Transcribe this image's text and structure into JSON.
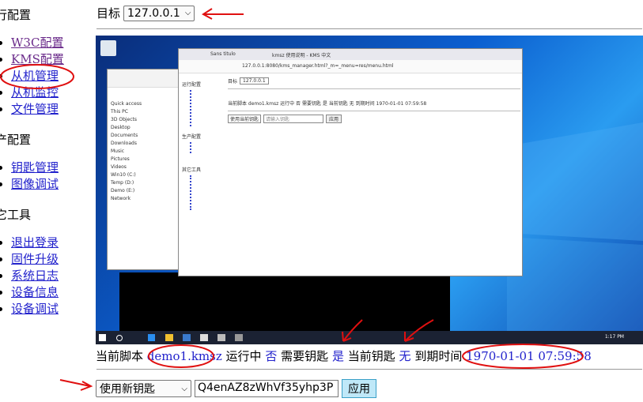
{
  "sidebar": {
    "sections": [
      {
        "title": "行配置",
        "items": [
          "W3C配置",
          "KMS配置",
          "从机管理",
          "从机监控",
          "文件管理"
        ]
      },
      {
        "title": "产配置",
        "items": [
          "钥匙管理",
          "图像调试"
        ]
      },
      {
        "title": "它工具",
        "items": [
          "退出登录",
          "固件升级",
          "系统日志",
          "设备信息",
          "设备调试"
        ]
      }
    ]
  },
  "header": {
    "target_label": "目标",
    "target_value": "127.0.0.1"
  },
  "status": {
    "script_label": "当前脚本",
    "script_value": "demo1.kmsz",
    "running_label": "运行中",
    "running_value": "否",
    "need_key_label": "需要钥匙",
    "need_key_value": "是",
    "current_key_label": "当前钥匙",
    "current_key_value": "无",
    "expire_label": "到期时间",
    "expire_value": "1970-01-01 07:59:58"
  },
  "controls": {
    "key_mode_value": "使用新钥匙",
    "key_input_value": "Q4enAZ8zWhVf35yhp3P",
    "apply_label": "应用"
  },
  "inner_screen": {
    "tab_title": "Sans titulo",
    "tab2_title": "kmsz 使用说明 - KMS 中文",
    "address": "127.0.0.1:8080/kms_manager.html?_m=_menu=res/menu.html",
    "target_label": "目标",
    "target_value": "127.0.0.1",
    "status_line": "当前脚本 demo1.kmsz 运行中 否 需要钥匙 是 当前钥匙 无 到期时间 1970-01-01 07:59:58",
    "mode_value": "使用当前钥匙",
    "input_placeholder": "请输入钥匙",
    "apply_label": "应用",
    "sections": [
      "运行配置",
      "生产配置",
      "其它工具"
    ],
    "explorer_items": [
      "Quick access",
      "This PC",
      "3D Objects",
      "Desktop",
      "Documents",
      "Downloads",
      "Music",
      "Pictures",
      "Videos",
      "Win10 (C:)",
      "Temp (D:)",
      "Demo (E:)",
      "Network"
    ],
    "clock": "1:17 PM"
  },
  "colors": {
    "link": "#2222cc",
    "visited": "#6a2a8a",
    "annotation": "#e01010",
    "apply_bg": "#bfe8f8"
  }
}
